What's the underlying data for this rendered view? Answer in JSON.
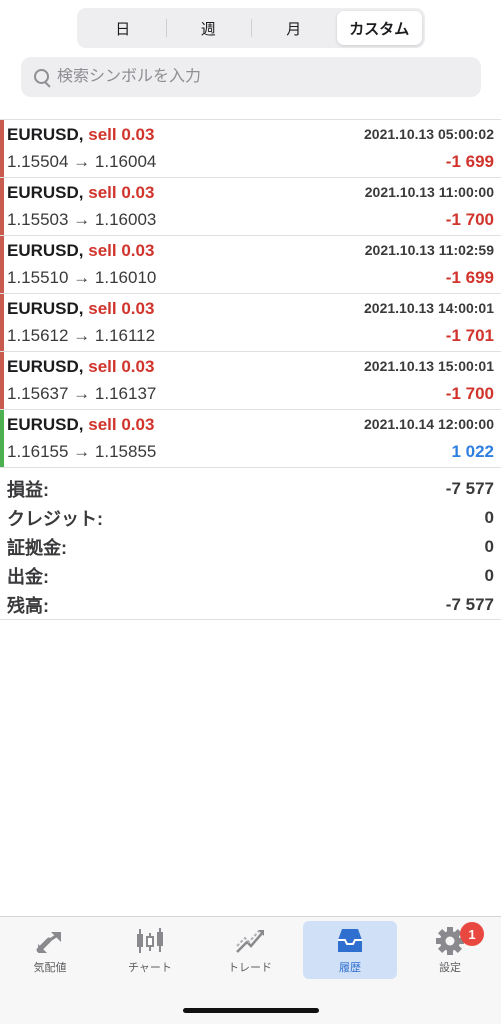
{
  "segments": [
    "日",
    "週",
    "月",
    "カスタム"
  ],
  "active_segment": "カスタム",
  "search": {
    "placeholder": "検索シンボルを入力",
    "value": ""
  },
  "trades": [
    {
      "symbol": "EURUSD,",
      "side": "sell 0.03",
      "time": "2021.10.13 05:00:02",
      "prices": "1.15504 → 1.16004",
      "profit": "-1 699",
      "status": "loss"
    },
    {
      "symbol": "EURUSD,",
      "side": "sell 0.03",
      "time": "2021.10.13 11:00:00",
      "prices": "1.15503 → 1.16003",
      "profit": "-1 700",
      "status": "loss"
    },
    {
      "symbol": "EURUSD,",
      "side": "sell 0.03",
      "time": "2021.10.13 11:02:59",
      "prices": "1.15510 → 1.16010",
      "profit": "-1 699",
      "status": "loss"
    },
    {
      "symbol": "EURUSD,",
      "side": "sell 0.03",
      "time": "2021.10.13 14:00:01",
      "prices": "1.15612 → 1.16112",
      "profit": "-1 701",
      "status": "loss"
    },
    {
      "symbol": "EURUSD,",
      "side": "sell 0.03",
      "time": "2021.10.13 15:00:01",
      "prices": "1.15637 → 1.16137",
      "profit": "-1 700",
      "status": "loss"
    },
    {
      "symbol": "EURUSD,",
      "side": "sell 0.03",
      "time": "2021.10.14 12:00:00",
      "prices": "1.16155 → 1.15855",
      "profit": "1 022",
      "status": "profit"
    }
  ],
  "summary": [
    {
      "label": "損益:",
      "value": "-7 577"
    },
    {
      "label": "クレジット:",
      "value": "0"
    },
    {
      "label": "証拠金:",
      "value": "0"
    },
    {
      "label": "出金:",
      "value": "0"
    },
    {
      "label": "残高:",
      "value": "-7 577"
    }
  ],
  "tabs": [
    {
      "label": "気配値",
      "icon": "quotes-icon"
    },
    {
      "label": "チャート",
      "icon": "chart-icon"
    },
    {
      "label": "トレード",
      "icon": "trade-icon"
    },
    {
      "label": "履歴",
      "icon": "history-icon"
    },
    {
      "label": "設定",
      "icon": "settings-icon"
    }
  ],
  "active_tab": "履歴",
  "settings_badge": "1",
  "colors": {
    "loss": "#d0342c",
    "profit": "#2f7fe0",
    "loss_bar": "#c85a50",
    "profit_bar": "#4caf50",
    "accent": "#2f6fcf",
    "active_tab_bg": "#cfe0f7"
  }
}
